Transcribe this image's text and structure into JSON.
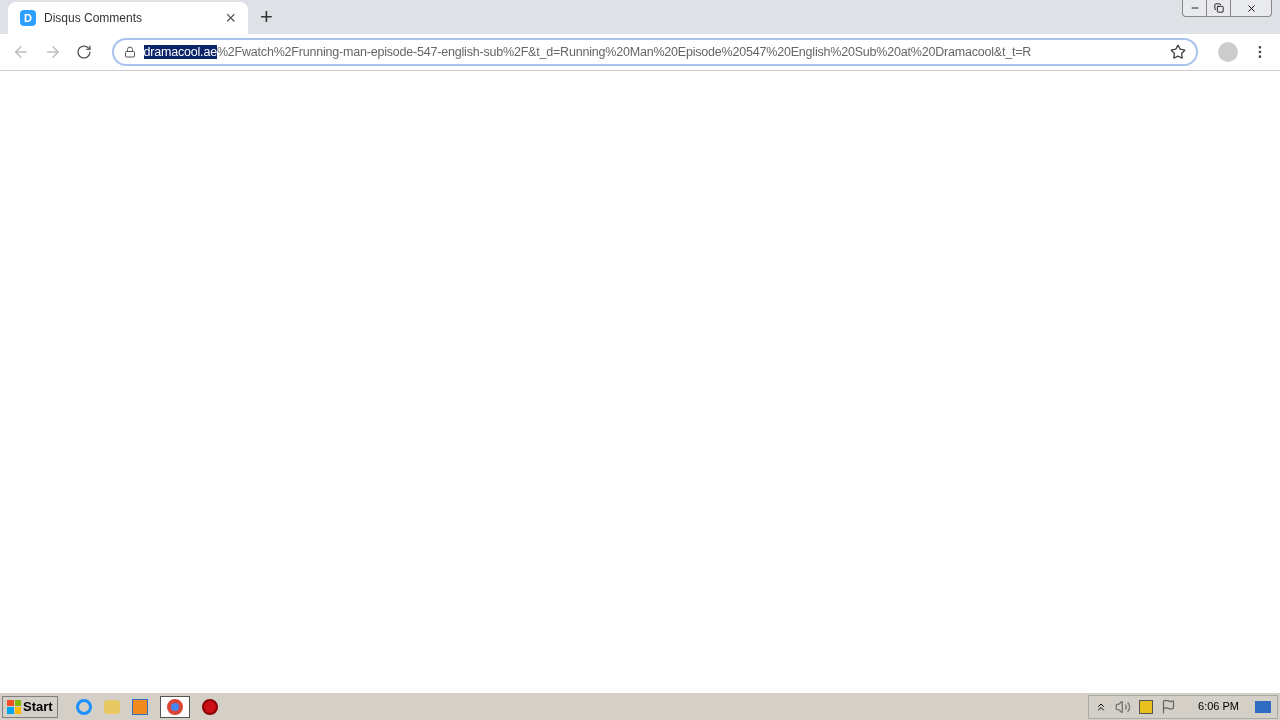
{
  "tab": {
    "favicon": "D",
    "title": "Disqus Comments",
    "close": "×",
    "selected": true
  },
  "new_tab": "+",
  "address_bar": {
    "selected_text": "dramacool.ae",
    "text": "%2Fwatch%2Frunning-man-episode-547-english-sub%2F&t_d=Running%20Man%20Episode%20547%20English%20Sub%20at%20Dramacool&t_t=R"
  },
  "taskbar": {
    "start": "Start",
    "clock": "6:06 PM"
  }
}
